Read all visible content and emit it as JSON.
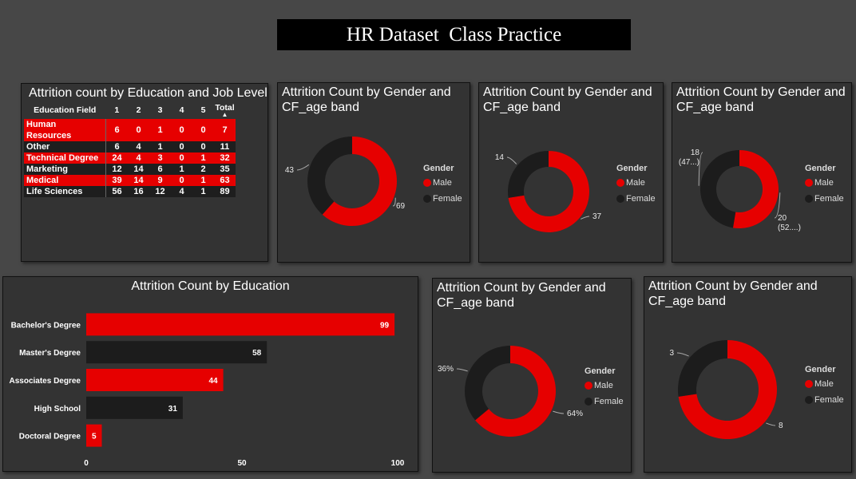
{
  "title": "HR Dataset  Class Practice",
  "colors": {
    "male": "#e60000",
    "female": "#1c1c1c",
    "panel": "#333333",
    "background": "#474747"
  },
  "matrix": {
    "title": "Attrition count by Education and Job Level",
    "headers": [
      "Education Field",
      "1",
      "2",
      "3",
      "4",
      "5",
      "Total"
    ],
    "sort_icon": "sort-ascending-icon",
    "rows": [
      {
        "field": "Human Resources",
        "v1": "6",
        "v2": "0",
        "v3": "1",
        "v4": "0",
        "v5": "0",
        "total": "7",
        "highlight": true
      },
      {
        "field": "Other",
        "v1": "6",
        "v2": "4",
        "v3": "1",
        "v4": "0",
        "v5": "0",
        "total": "11",
        "highlight": false
      },
      {
        "field": "Technical Degree",
        "v1": "24",
        "v2": "4",
        "v3": "3",
        "v4": "0",
        "v5": "1",
        "total": "32",
        "highlight": true
      },
      {
        "field": "Marketing",
        "v1": "12",
        "v2": "14",
        "v3": "6",
        "v4": "1",
        "v5": "2",
        "total": "35",
        "highlight": false
      },
      {
        "field": "Medical",
        "v1": "39",
        "v2": "14",
        "v3": "9",
        "v4": "0",
        "v5": "1",
        "total": "63",
        "highlight": true
      },
      {
        "field": "Life Sciences",
        "v1": "56",
        "v2": "16",
        "v3": "12",
        "v4": "4",
        "v5": "1",
        "total": "89",
        "highlight": false
      }
    ]
  },
  "chart_data": [
    {
      "id": "bar-education",
      "type": "bar",
      "orientation": "horizontal",
      "title": "Attrition Count by Education",
      "categories": [
        "Bachelor's Degree",
        "Master's Degree",
        "Associates Degree",
        "High School",
        "Doctoral Degree"
      ],
      "values": [
        99,
        58,
        44,
        31,
        5
      ],
      "bar_colors": [
        "#e60000",
        "#1c1c1c",
        "#e60000",
        "#1c1c1c",
        "#e60000"
      ],
      "xlim": [
        0,
        100
      ],
      "xticks": [
        "0",
        "50",
        "100"
      ],
      "grid": false
    },
    {
      "id": "donut-1",
      "type": "pie",
      "donut": true,
      "title": "Attrition Count by Gender and CF_age band",
      "legend_title": "Gender",
      "legend_position": "right",
      "slices": [
        {
          "name": "Male",
          "value": 69,
          "label": "69"
        },
        {
          "name": "Female",
          "value": 43,
          "label": "43"
        }
      ]
    },
    {
      "id": "donut-2",
      "type": "pie",
      "donut": true,
      "title": "Attrition Count by Gender and CF_age band",
      "legend_title": "Gender",
      "legend_position": "right",
      "slices": [
        {
          "name": "Male",
          "value": 37,
          "label": "37"
        },
        {
          "name": "Female",
          "value": 14,
          "label": "14"
        }
      ]
    },
    {
      "id": "donut-3",
      "type": "pie",
      "donut": true,
      "title": "Attrition Count by Gender and CF_age band",
      "legend_title": "Gender",
      "legend_position": "right",
      "slices": [
        {
          "name": "Male",
          "value": 20,
          "label": "20",
          "sublabel": "(52....)"
        },
        {
          "name": "Female",
          "value": 18,
          "label": "18",
          "sublabel": "(47...)"
        }
      ]
    },
    {
      "id": "donut-4",
      "type": "pie",
      "donut": true,
      "title": "Attrition Count by Gender and CF_age band",
      "legend_title": "Gender",
      "legend_position": "right",
      "slices": [
        {
          "name": "Male",
          "value": 64,
          "label": "64%"
        },
        {
          "name": "Female",
          "value": 36,
          "label": "36%"
        }
      ]
    },
    {
      "id": "donut-5",
      "type": "pie",
      "donut": true,
      "title": "Attrition Count by Gender and CF_age band",
      "legend_title": "Gender",
      "legend_position": "right",
      "slices": [
        {
          "name": "Male",
          "value": 8,
          "label": "8"
        },
        {
          "name": "Female",
          "value": 3,
          "label": "3"
        }
      ]
    }
  ]
}
